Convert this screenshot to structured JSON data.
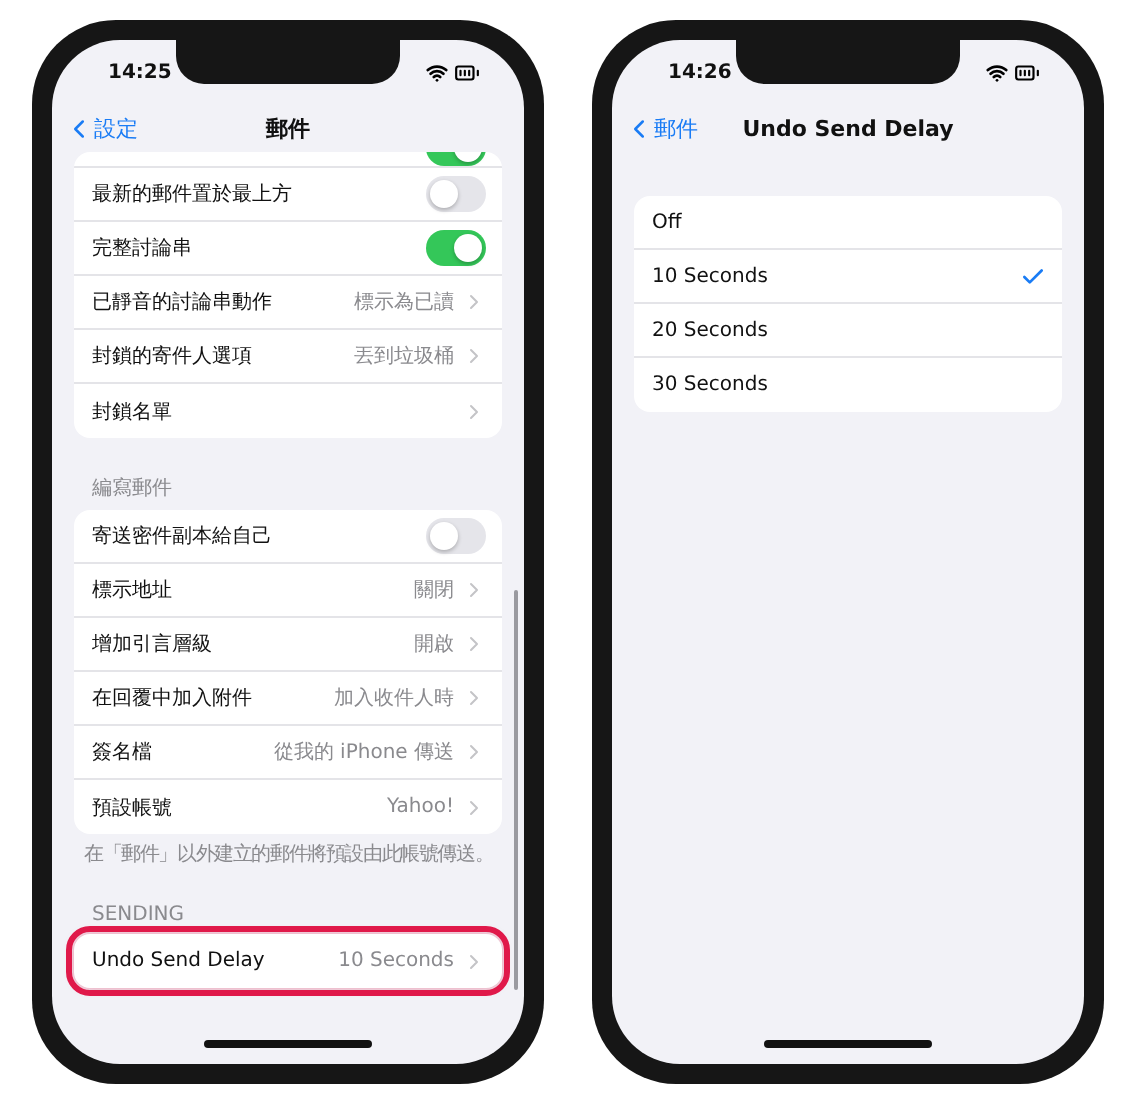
{
  "phones": [
    {
      "status_bar": {
        "time": "14:25"
      },
      "nav": {
        "back": "設定",
        "title": "郵件"
      },
      "sections": [
        {
          "rows": [
            {
              "kind": "partial-toggle",
              "on": true
            },
            {
              "kind": "toggle",
              "label": "最新的郵件置於最上方",
              "on": false
            },
            {
              "kind": "toggle",
              "label": "完整討論串",
              "on": true
            },
            {
              "kind": "link",
              "label": "已靜音的討論串動作",
              "value": "標示為已讀"
            },
            {
              "kind": "link",
              "label": "封鎖的寄件人選項",
              "value": "丟到垃圾桶"
            },
            {
              "kind": "link",
              "label": "封鎖名單"
            }
          ],
          "highlighted": false
        },
        {
          "header": "編寫郵件",
          "rows": [
            {
              "kind": "toggle",
              "label": "寄送密件副本給自己",
              "on": false
            },
            {
              "kind": "link",
              "label": "標示地址",
              "value": "關閉"
            },
            {
              "kind": "link",
              "label": "增加引言層級",
              "value": "開啟"
            },
            {
              "kind": "link",
              "label": "在回覆中加入附件",
              "value": "加入收件人時"
            },
            {
              "kind": "link",
              "label": "簽名檔",
              "value": "從我的 iPhone 傳送"
            },
            {
              "kind": "link",
              "label": "預設帳號",
              "value": "Yahoo!"
            }
          ],
          "footer": "在「郵件」以外建立的郵件將預設由此帳號傳送。",
          "highlighted": false
        },
        {
          "header": "SENDING",
          "rows": [
            {
              "kind": "link",
              "label": "Undo Send Delay",
              "value": "10 Seconds"
            }
          ],
          "highlighted": true
        }
      ]
    },
    {
      "status_bar": {
        "time": "14:26"
      },
      "nav": {
        "back": "郵件",
        "title": "Undo Send Delay"
      },
      "options": [
        {
          "label": "Off",
          "selected": false
        },
        {
          "label": "10 Seconds",
          "selected": true
        },
        {
          "label": "20 Seconds",
          "selected": false
        },
        {
          "label": "30 Seconds",
          "selected": false
        }
      ]
    }
  ]
}
